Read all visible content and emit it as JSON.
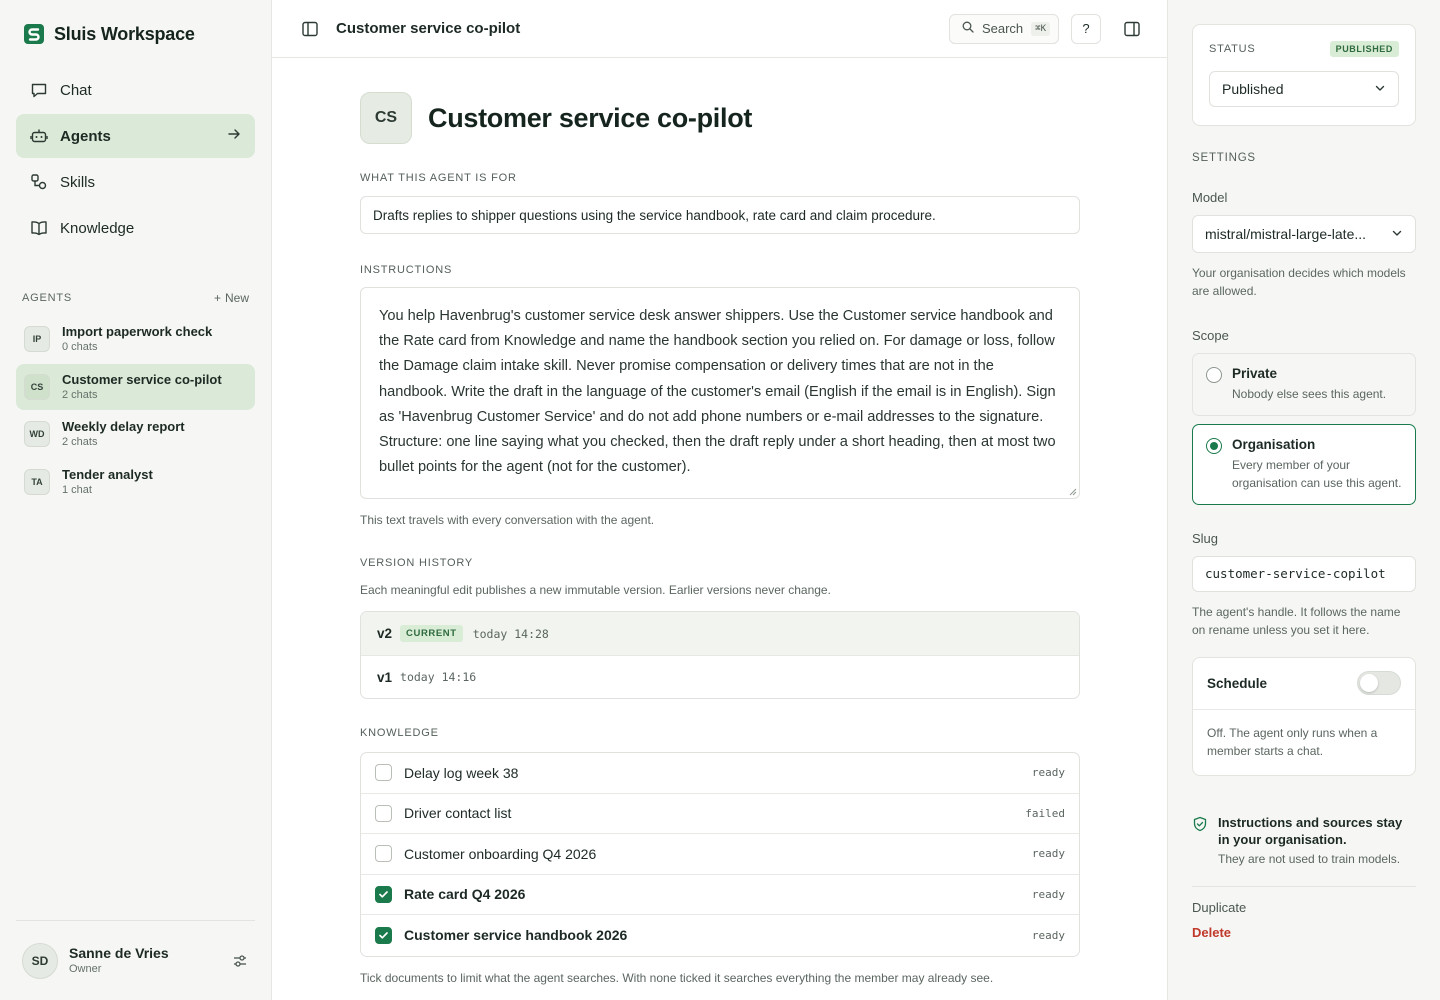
{
  "sidebar": {
    "brand": "Sluis Workspace",
    "nav": [
      {
        "label": "Chat",
        "icon": "chat-bubble-icon",
        "active": false
      },
      {
        "label": "Agents",
        "icon": "robot-icon",
        "active": true
      },
      {
        "label": "Skills",
        "icon": "skills-icon",
        "active": false
      },
      {
        "label": "Knowledge",
        "icon": "book-icon",
        "active": false
      }
    ],
    "agents_heading": "AGENTS",
    "new_label": "New",
    "agents": [
      {
        "initials": "IP",
        "name": "Import paperwork check",
        "sub": "0 chats",
        "active": false
      },
      {
        "initials": "CS",
        "name": "Customer service co-pilot",
        "sub": "2 chats",
        "active": true
      },
      {
        "initials": "WD",
        "name": "Weekly delay report",
        "sub": "2 chats",
        "active": false
      },
      {
        "initials": "TA",
        "name": "Tender analyst",
        "sub": "1 chat",
        "active": false
      }
    ],
    "user": {
      "initials": "SD",
      "name": "Sanne de Vries",
      "role": "Owner"
    }
  },
  "topbar": {
    "title": "Customer service co-pilot",
    "search_label": "Search",
    "search_shortcut": "⌘K",
    "help_label": "?"
  },
  "main": {
    "initials": "CS",
    "title": "Customer service co-pilot",
    "purpose_label": "WHAT THIS AGENT IS FOR",
    "purpose_value": "Drafts replies to shipper questions using the service handbook, rate card and claim procedure.",
    "instructions_label": "INSTRUCTIONS",
    "instructions_value": "You help Havenbrug's customer service desk answer shippers. Use the Customer service handbook and the Rate card from Knowledge and name the handbook section you relied on. For damage or loss, follow the Damage claim intake skill. Never promise compensation or delivery times that are not in the handbook. Write the draft in the language of the customer's email (English if the email is in English). Sign as 'Havenbrug Customer Service' and do not add phone numbers or e-mail addresses to the signature. Structure: one line saying what you checked, then the draft reply under a short heading, then at most two bullet points for the agent (not for the customer).",
    "instructions_hint": "This text travels with every conversation with the agent.",
    "version_label": "VERSION HISTORY",
    "version_desc": "Each meaningful edit publishes a new immutable version. Earlier versions never change.",
    "versions": [
      {
        "version": "v2",
        "badge": "CURRENT",
        "time": "today 14:28",
        "current": true
      },
      {
        "version": "v1",
        "badge": "",
        "time": "today 14:16",
        "current": false
      }
    ],
    "knowledge_label": "KNOWLEDGE",
    "knowledge": [
      {
        "name": "Delay log week 38",
        "status": "ready",
        "checked": false
      },
      {
        "name": "Driver contact list",
        "status": "failed",
        "checked": false
      },
      {
        "name": "Customer onboarding Q4 2026",
        "status": "ready",
        "checked": false
      },
      {
        "name": "Rate card Q4 2026",
        "status": "ready",
        "checked": true
      },
      {
        "name": "Customer service handbook 2026",
        "status": "ready",
        "checked": true
      }
    ],
    "knowledge_hint": "Tick documents to limit what the agent searches. With none ticked it searches everything the member may already see."
  },
  "rpanel": {
    "status_label": "STATUS",
    "status_badge": "PUBLISHED",
    "status_value": "Published",
    "settings_label": "SETTINGS",
    "model_label": "Model",
    "model_value": "mistral/mistral-large-late...",
    "model_hint": "Your organisation decides which models are allowed.",
    "scope_label": "Scope",
    "scope_options": [
      {
        "title": "Private",
        "desc": "Nobody else sees this agent.",
        "selected": false
      },
      {
        "title": "Organisation",
        "desc": "Every member of your organisation can use this agent.",
        "selected": true
      }
    ],
    "slug_label": "Slug",
    "slug_value": "customer-service-copilot",
    "slug_hint": "The agent's handle. It follows the name on rename unless you set it here.",
    "schedule_label": "Schedule",
    "schedule_on": false,
    "schedule_desc": "Off. The agent only runs when a member starts a chat.",
    "privacy_title": "Instructions and sources stay in your organisation.",
    "privacy_desc": "They are not used to train models.",
    "duplicate_label": "Duplicate",
    "delete_label": "Delete"
  },
  "colors": {
    "accent": "#1a7a4b",
    "active_bg": "#dbe9d8",
    "danger": "#c0392b"
  }
}
